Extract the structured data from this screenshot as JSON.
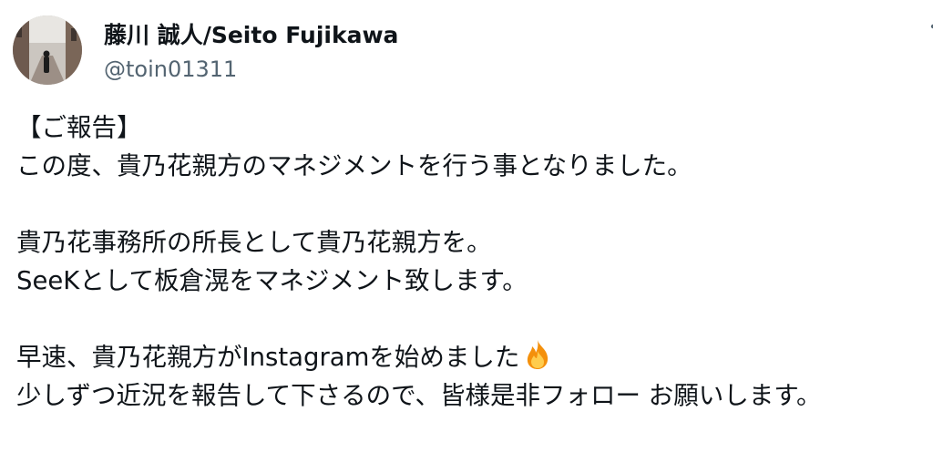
{
  "tweet": {
    "author": {
      "display_name": "藤川 誠人/Seito Fujikawa",
      "handle": "@toin01311"
    },
    "body": {
      "line1": "【ご報告】",
      "line2": "この度、貴乃花親方のマネジメントを行う事となりました。",
      "line4": "貴乃花事務所の所長として貴乃花親方を。",
      "line5": "SeeKとして板倉滉をマネジメント致します。",
      "line7": "早速、貴乃花親方がInstagramを始めました",
      "line8": "少しずつ近況を報告して下さるので、皆様是非フォロー お願いします。"
    },
    "icons": {
      "avatar": "profile-photo",
      "emoji": "fire-icon",
      "menu": "more-icon"
    }
  }
}
